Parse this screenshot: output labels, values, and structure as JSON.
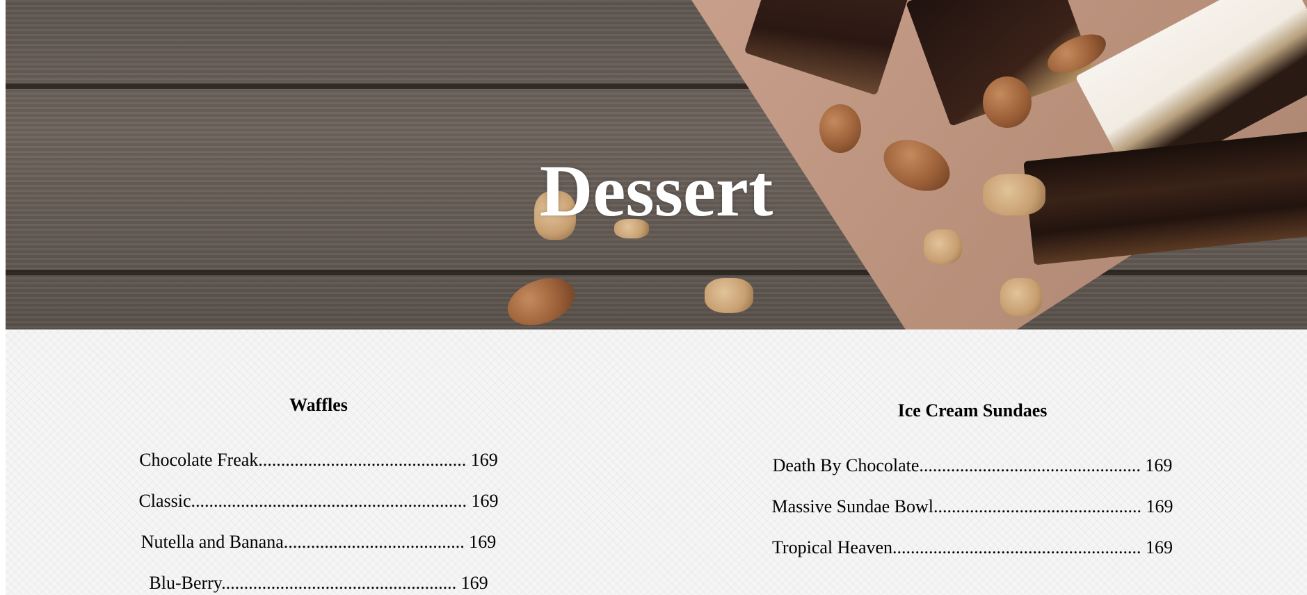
{
  "hero": {
    "title": "Dessert"
  },
  "sections": [
    {
      "heading": "Waffles",
      "items": [
        {
          "text": "Chocolate Freak.............................................. 169"
        },
        {
          "text": "Classic............................................................. 169"
        },
        {
          "text": "Nutella and Banana........................................ 169"
        },
        {
          "text": "Blu-Berry.................................................... 169"
        }
      ]
    },
    {
      "heading": "Ice Cream Sundaes",
      "items": [
        {
          "text": "Death By Chocolate................................................. 169"
        },
        {
          "text": "Massive Sundae Bowl.............................................. 169"
        },
        {
          "text": "Tropical Heaven....................................................... 169"
        }
      ]
    }
  ]
}
